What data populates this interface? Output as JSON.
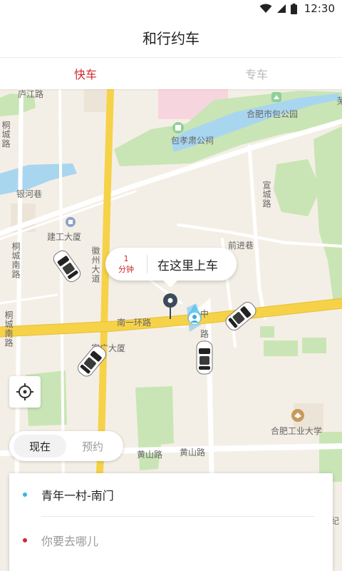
{
  "status_bar": {
    "time": "12:30",
    "icons": [
      "wifi-icon",
      "signal-icon",
      "battery-icon"
    ]
  },
  "header": {
    "title": "和行约车"
  },
  "tabs": [
    {
      "label": "快车",
      "active": true
    },
    {
      "label": "专车",
      "active": false
    }
  ],
  "map": {
    "labels": {
      "lujiang_rd": "庐江路",
      "baogong_park": "合肥市包公园",
      "baoxiaosu_shrine": "包孝肃公祠",
      "yinhe_lane": "银河巷",
      "jiangong_tower": "建工大厦",
      "huaizhou_ave": "徽州大道",
      "qianjin_lane": "前进巷",
      "nanyi_ring_rd": "南一环路",
      "huguang_tower": "富广大厦",
      "hefei_univ_tech": "合肥工业大学",
      "huangshan_rd_1": "黄山路",
      "huangshan_rd_2": "黄山路",
      "xuancheng_rd": "宣城路",
      "tongcheng_s_rd_1": "桐城路",
      "tongcheng_s_rd_2": "桐城南路",
      "tongcheng_s_rd_3": "桐城南路",
      "ji_edge": "纪",
      "wu_edge": "芜",
      "zhong_edge": "中",
      "lu_edge": "路"
    }
  },
  "pickup": {
    "eta_value": "1",
    "eta_unit": "分钟",
    "label": "在这里上车"
  },
  "colors": {
    "accent": "#d0282e",
    "from_dot": "#39b6e8",
    "to_dot": "#d0282e",
    "road_main": "#f6d248",
    "water": "#a9d6ef",
    "park": "#c9e5b5"
  },
  "time_toggle": {
    "now": "现在",
    "reserve": "预约",
    "selected": "now"
  },
  "route": {
    "from": "青年一村-南门",
    "to_placeholder": "你要去哪儿"
  }
}
